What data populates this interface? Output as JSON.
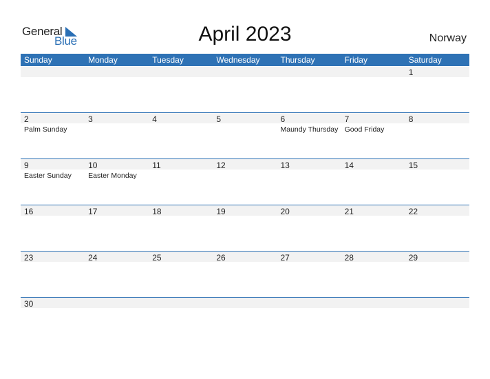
{
  "logo": {
    "word1": "General",
    "word2": "Blue"
  },
  "title": "April 2023",
  "country": "Norway",
  "colors": {
    "header": "#2e72b5",
    "band": "#f2f2f2",
    "brand": "#2a6fb5"
  },
  "weekdays": [
    "Sunday",
    "Monday",
    "Tuesday",
    "Wednesday",
    "Thursday",
    "Friday",
    "Saturday"
  ],
  "weeks": [
    [
      {
        "d": "",
        "e": ""
      },
      {
        "d": "",
        "e": ""
      },
      {
        "d": "",
        "e": ""
      },
      {
        "d": "",
        "e": ""
      },
      {
        "d": "",
        "e": ""
      },
      {
        "d": "",
        "e": ""
      },
      {
        "d": "1",
        "e": ""
      }
    ],
    [
      {
        "d": "2",
        "e": "Palm Sunday"
      },
      {
        "d": "3",
        "e": ""
      },
      {
        "d": "4",
        "e": ""
      },
      {
        "d": "5",
        "e": ""
      },
      {
        "d": "6",
        "e": "Maundy Thursday"
      },
      {
        "d": "7",
        "e": "Good Friday"
      },
      {
        "d": "8",
        "e": ""
      }
    ],
    [
      {
        "d": "9",
        "e": "Easter Sunday"
      },
      {
        "d": "10",
        "e": "Easter Monday"
      },
      {
        "d": "11",
        "e": ""
      },
      {
        "d": "12",
        "e": ""
      },
      {
        "d": "13",
        "e": ""
      },
      {
        "d": "14",
        "e": ""
      },
      {
        "d": "15",
        "e": ""
      }
    ],
    [
      {
        "d": "16",
        "e": ""
      },
      {
        "d": "17",
        "e": ""
      },
      {
        "d": "18",
        "e": ""
      },
      {
        "d": "19",
        "e": ""
      },
      {
        "d": "20",
        "e": ""
      },
      {
        "d": "21",
        "e": ""
      },
      {
        "d": "22",
        "e": ""
      }
    ],
    [
      {
        "d": "23",
        "e": ""
      },
      {
        "d": "24",
        "e": ""
      },
      {
        "d": "25",
        "e": ""
      },
      {
        "d": "26",
        "e": ""
      },
      {
        "d": "27",
        "e": ""
      },
      {
        "d": "28",
        "e": ""
      },
      {
        "d": "29",
        "e": ""
      }
    ],
    [
      {
        "d": "30",
        "e": ""
      },
      {
        "d": "",
        "e": ""
      },
      {
        "d": "",
        "e": ""
      },
      {
        "d": "",
        "e": ""
      },
      {
        "d": "",
        "e": ""
      },
      {
        "d": "",
        "e": ""
      },
      {
        "d": "",
        "e": ""
      }
    ]
  ]
}
